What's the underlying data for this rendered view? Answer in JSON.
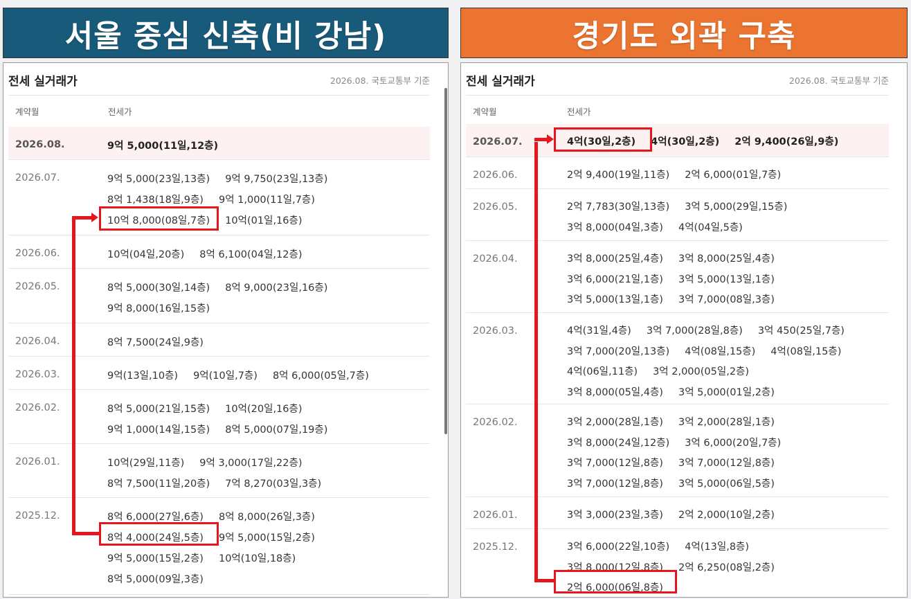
{
  "left": {
    "banner": "서울 중심 신축(비 강남)",
    "title": "전세 실거래가",
    "source": "2026.08. 국토교통부 기준",
    "col_month": "계약월",
    "col_price": "전세가",
    "rows": [
      {
        "month": "2026.08.",
        "lines": [
          [
            "9억 5,000(11일,12층)"
          ]
        ]
      },
      {
        "month": "2026.07.",
        "lines": [
          [
            "9억 5,000(23일,13층)",
            "9억 9,750(23일,13층)"
          ],
          [
            "8억 1,438(18일,9층)",
            "9억 1,000(11일,7층)"
          ],
          [
            "10억 8,000(08일,7층)",
            "10억(01일,16층)"
          ]
        ]
      },
      {
        "month": "2026.06.",
        "lines": [
          [
            "10억(04일,20층)",
            "8억 6,100(04일,12층)"
          ]
        ]
      },
      {
        "month": "2026.05.",
        "lines": [
          [
            "8억 5,000(30일,14층)",
            "8억 9,000(23일,16층)"
          ],
          [
            "9억 8,000(16일,15층)"
          ]
        ]
      },
      {
        "month": "2026.04.",
        "lines": [
          [
            "8억 7,500(24일,9층)"
          ]
        ]
      },
      {
        "month": "2026.03.",
        "lines": [
          [
            "9억(13일,10층)",
            "9억(10일,7층)",
            "8억 6,000(05일,7층)"
          ]
        ]
      },
      {
        "month": "2026.02.",
        "lines": [
          [
            "8억 5,000(21일,15층)",
            "10억(20일,16층)"
          ],
          [
            "9억 1,000(14일,15층)",
            "8억 5,000(07일,19층)"
          ]
        ]
      },
      {
        "month": "2026.01.",
        "lines": [
          [
            "10억(29일,11층)",
            "9억 3,000(17일,22층)"
          ],
          [
            "8억 7,500(11일,20층)",
            "7억 8,270(03일,3층)"
          ]
        ]
      },
      {
        "month": "2025.12.",
        "lines": [
          [
            "8억 6,000(27일,6층)",
            "8억 8,000(26일,3층)"
          ],
          [
            "8억 4,000(24일,5층)",
            "9억 5,000(15일,2층)"
          ],
          [
            "9억 5,000(15일,2층)",
            "10억(10일,18층)"
          ],
          [
            "8억 5,000(09일,3층)"
          ]
        ]
      }
    ]
  },
  "right": {
    "banner": "경기도 외곽 구축",
    "title": "전세 실거래가",
    "source": "2026.08. 국토교통부 기준",
    "col_month": "계약월",
    "col_price": "전세가",
    "rows": [
      {
        "month": "2026.07.",
        "lines": [
          [
            "4억(30일,2층)",
            "4억(30일,2층)",
            "2억 9,400(26일,9층)"
          ]
        ]
      },
      {
        "month": "2026.06.",
        "lines": [
          [
            "2억 9,400(19일,11층)",
            "2억 6,000(01일,7층)"
          ]
        ]
      },
      {
        "month": "2026.05.",
        "lines": [
          [
            "2억 7,783(30일,13층)",
            "3억 5,000(29일,15층)"
          ],
          [
            "3억 8,000(04일,3층)",
            "4억(04일,5층)"
          ]
        ]
      },
      {
        "month": "2026.04.",
        "lines": [
          [
            "3억 8,000(25일,4층)",
            "3억 8,000(25일,4층)"
          ],
          [
            "3억 6,000(21일,1층)",
            "3억 5,000(13일,1층)"
          ],
          [
            "3억 5,000(13일,1층)",
            "3억 7,000(08일,3층)"
          ]
        ]
      },
      {
        "month": "2026.03.",
        "lines": [
          [
            "4억(31일,4층)",
            "3억 7,000(28일,8층)",
            "3억 450(25일,7층)"
          ],
          [
            "3억 7,000(20일,13층)",
            "4억(08일,15층)",
            "4억(08일,15층)"
          ],
          [
            "4억(06일,11층)",
            "3억 2,000(05일,2층)"
          ],
          [
            "3억 8,000(05일,4층)",
            "3억 5,000(01일,2층)"
          ]
        ]
      },
      {
        "month": "2026.02.",
        "lines": [
          [
            "3억 2,000(28일,1층)",
            "3억 2,000(28일,1층)"
          ],
          [
            "3억 8,000(24일,12층)",
            "3억 6,000(20일,7층)"
          ],
          [
            "3억 7,000(12일,8층)",
            "3억 7,000(12일,8층)"
          ],
          [
            "3억 7,000(12일,8층)",
            "3억 5,000(06일,5층)"
          ]
        ]
      },
      {
        "month": "2026.01.",
        "lines": [
          [
            "3억 3,000(23일,3층)",
            "2억 2,000(10일,2층)"
          ]
        ]
      },
      {
        "month": "2025.12.",
        "lines": [
          [
            "3억 6,000(22일,10층)",
            "4억(13일,8층)"
          ],
          [
            "3억 8,000(12일,8층)",
            "2억 6,250(08일,2층)"
          ],
          [
            "2억 6,000(06일,8층)"
          ]
        ]
      }
    ]
  },
  "colors": {
    "left_banner": "#185a7a",
    "right_banner": "#ea7430",
    "marker": "#e5161e",
    "highlight_row": "#fdf1f1"
  }
}
